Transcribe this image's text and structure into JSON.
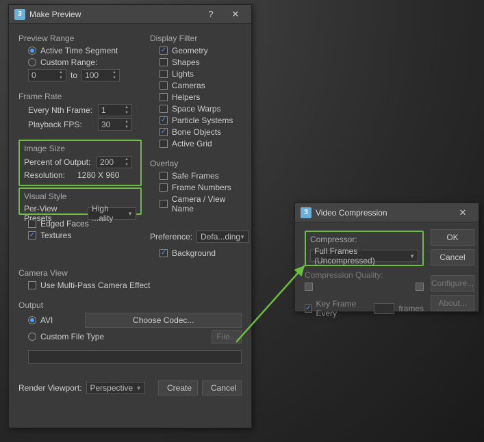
{
  "makePreview": {
    "title": "Make Preview",
    "helpGlyph": "?",
    "closeGlyph": "✕",
    "previewRange": {
      "label": "Preview Range",
      "activeTimeSegment": "Active Time Segment",
      "customRange": "Custom Range:",
      "start": "0",
      "to": "to",
      "end": "100"
    },
    "frameRate": {
      "label": "Frame Rate",
      "everyNth": "Every Nth Frame:",
      "everyNthVal": "1",
      "playbackFps": "Playback FPS:",
      "playbackFpsVal": "30"
    },
    "imageSize": {
      "label": "Image Size",
      "percentLabel": "Percent of Output:",
      "percentVal": "200",
      "resolutionLabel": "Resolution:",
      "resolutionVal": "1280  X   960"
    },
    "visualStyle": {
      "label": "Visual Style",
      "perViewPresets": "Per-View Presets",
      "presetVal": "High ...ality",
      "edgedFaces": "Edged Faces",
      "textures": "Textures"
    },
    "preference": {
      "label": "Preference:",
      "val": "Defa...ding",
      "background": "Background"
    },
    "cameraView": {
      "label": "Camera View",
      "multiPass": "Use Multi-Pass Camera Effect"
    },
    "output": {
      "label": "Output",
      "avi": "AVI",
      "chooseCodec": "Choose Codec...",
      "customFileType": "Custom File Type",
      "fileBtn": "File..."
    },
    "displayFilter": {
      "label": "Display Filter",
      "items": [
        {
          "label": "Geometry",
          "checked": true
        },
        {
          "label": "Shapes",
          "checked": false
        },
        {
          "label": "Lights",
          "checked": false
        },
        {
          "label": "Cameras",
          "checked": false
        },
        {
          "label": "Helpers",
          "checked": false
        },
        {
          "label": "Space Warps",
          "checked": false
        },
        {
          "label": "Particle Systems",
          "checked": true
        },
        {
          "label": "Bone Objects",
          "checked": true
        },
        {
          "label": "Active Grid",
          "checked": false
        }
      ]
    },
    "overlay": {
      "label": "Overlay",
      "items": [
        {
          "label": "Safe Frames",
          "checked": false
        },
        {
          "label": "Frame Numbers",
          "checked": false
        },
        {
          "label": "Camera / View Name",
          "checked": false
        }
      ]
    },
    "renderViewport": {
      "label": "Render Viewport:",
      "val": "Perspective",
      "create": "Create",
      "cancel": "Cancel"
    }
  },
  "videoCompression": {
    "title": "Video Compression",
    "closeGlyph": "✕",
    "compressorLabel": "Compressor:",
    "compressorVal": "Full Frames (Uncompressed)",
    "qualityLabel": "Compression Quality:",
    "keyFrameEvery": "Key Frame Every",
    "framesLabel": "frames",
    "ok": "OK",
    "cancel": "Cancel",
    "configure": "Configure...",
    "about": "About..."
  }
}
